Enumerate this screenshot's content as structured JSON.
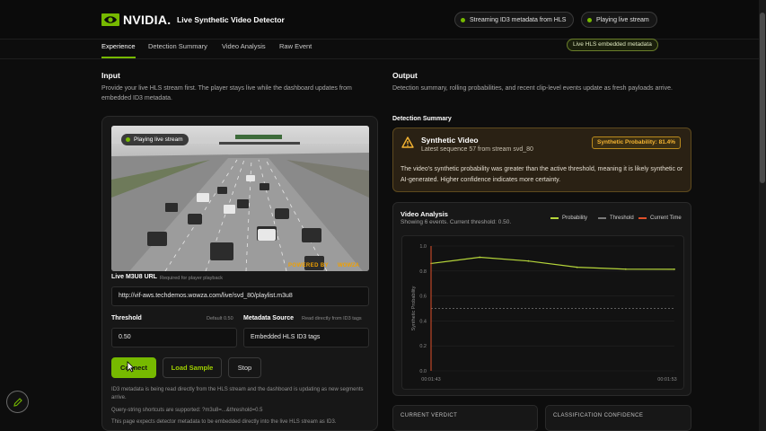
{
  "header": {
    "logo_text": "NVIDIA.",
    "app_title": "Live Synthetic Video Detector",
    "status_pills": [
      "Streaming ID3 metadata from HLS",
      "Playing live stream"
    ]
  },
  "tabs": [
    "Experience",
    "Detection Summary",
    "Video Analysis",
    "Raw Event"
  ],
  "active_tab": "Experience",
  "live_badge": "Live HLS embedded metadata",
  "input": {
    "title": "Input",
    "description": "Provide your live HLS stream first. The player stays live while the dashboard updates from embedded ID3 metadata.",
    "video_badge": "Playing live stream",
    "powered_by": "POWERED BY",
    "powered_brand": "WOWZA",
    "url_label": "Live M3U8 URL",
    "url_hint": "Required for player playback",
    "url_value": "http://vif-aws.techdemos.wowza.com/live/svd_80/playlist.m3u8",
    "threshold_label": "Threshold",
    "threshold_default": "Default 0.50",
    "threshold_value": "0.50",
    "metadata_label": "Metadata Source",
    "metadata_hint": "Read directly from ID3 tags",
    "metadata_value": "Embedded HLS ID3 tags",
    "buttons": {
      "connect": "Connect",
      "load_sample": "Load Sample",
      "stop": "Stop"
    },
    "notes": [
      "ID3 metadata is being read directly from the HLS stream and the dashboard is updating as new segments arrive.",
      "Query-string shortcuts are supported: ?m3u8=...&threshold=0.5",
      "This page expects detector metadata to be embedded directly into the live HLS stream as ID3."
    ]
  },
  "output": {
    "title": "Output",
    "description": "Detection summary, rolling probabilities, and recent clip-level events update as fresh payloads arrive.",
    "summary_label": "Detection Summary",
    "alert": {
      "title": "Synthetic Video",
      "subtitle": "Latest sequence 57 from stream svd_80",
      "badge": "Synthetic Probability: 81.4%",
      "body": "The video's synthetic probability was greater than the active threshold, meaning it is likely synthetic or AI-generated. Higher confidence indicates more certainty.",
      "color": "#f5b432"
    },
    "video_analysis": {
      "title": "Video Analysis",
      "subtitle": "Showing 6 events. Current threshold: 0.50.",
      "legend": [
        "Probability",
        "Threshold",
        "Current Time"
      ]
    },
    "verdict_label": "CURRENT VERDICT",
    "confidence_label": "CLASSIFICATION CONFIDENCE"
  },
  "colors": {
    "accent": "#76b900",
    "probability_line": "#b5d53a",
    "threshold_line": "#7a7a7a",
    "current_time_line": "#e0502a"
  },
  "chart_data": {
    "type": "line",
    "xlabel": "",
    "ylabel": "Synthetic Probability",
    "ylim": [
      0,
      1.0
    ],
    "yticks": [
      "0.0",
      "0.2",
      "0.4",
      "0.6",
      "0.8",
      "1.0"
    ],
    "x_ticks": [
      "00:01:43",
      "00:01:53"
    ],
    "x": [
      0,
      1,
      2,
      3,
      4,
      5
    ],
    "series": [
      {
        "name": "Probability",
        "values": [
          0.86,
          0.91,
          0.88,
          0.83,
          0.815,
          0.814
        ]
      }
    ],
    "threshold": 0.5,
    "current_time_index": 0,
    "grid": true
  }
}
